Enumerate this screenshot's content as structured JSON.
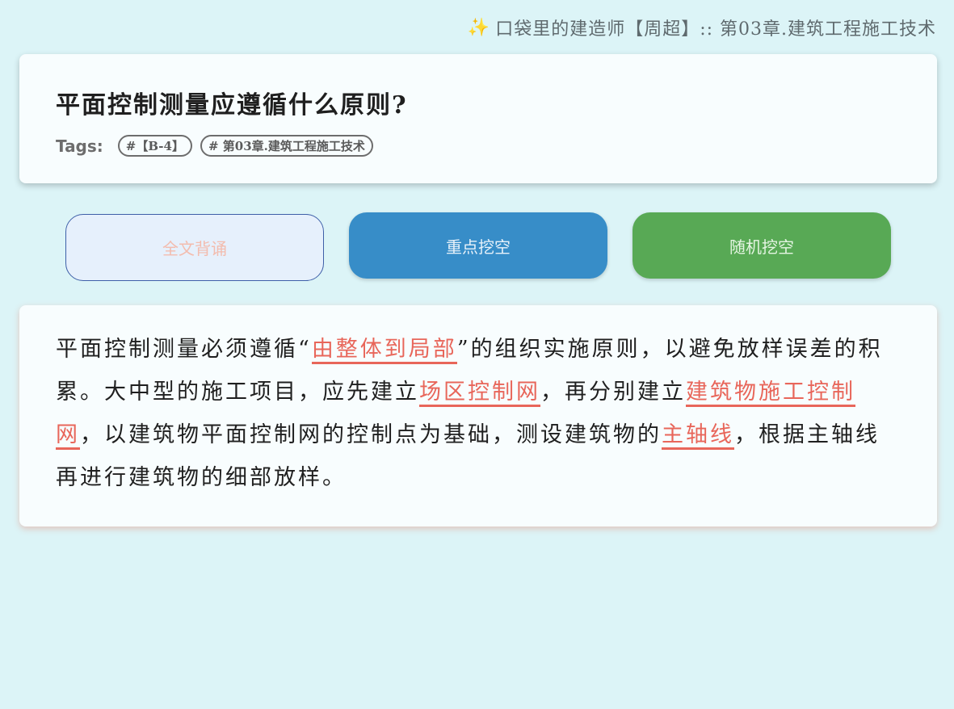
{
  "breadcrumb": {
    "icon": "sparkle-icon",
    "text": "口袋里的建造师【周超】:: 第03章.建筑工程施工技术"
  },
  "question": {
    "title": "平面控制测量应遵循什么原则?",
    "tags_label": "Tags:",
    "tags": [
      "#【B-4】",
      "# 第03章.建筑工程施工技术"
    ]
  },
  "buttons": {
    "full_recite": "全文背诵",
    "key_blank": "重点挖空",
    "random_blank": "随机挖空"
  },
  "answer": {
    "t1": "平面控制测量必须遵循“",
    "k1": "由整体到局部",
    "t2": "”的组织实施原则，以避免放样误差的积累。大中型的施工项目，应先建立",
    "k2": "场区控制网",
    "t3": "，再分别建立",
    "k3": "建筑物施工控制网",
    "t4": "，以建筑物平面控制网的控制点为基础，测设建筑物的",
    "k4": "主轴线",
    "t5": "，根据主轴线再进行建筑物的细部放样。"
  },
  "colors": {
    "background": "#dcf4f7",
    "keyword": "#e8665a",
    "key_button": "#378dc8",
    "random_button": "#58a955"
  }
}
